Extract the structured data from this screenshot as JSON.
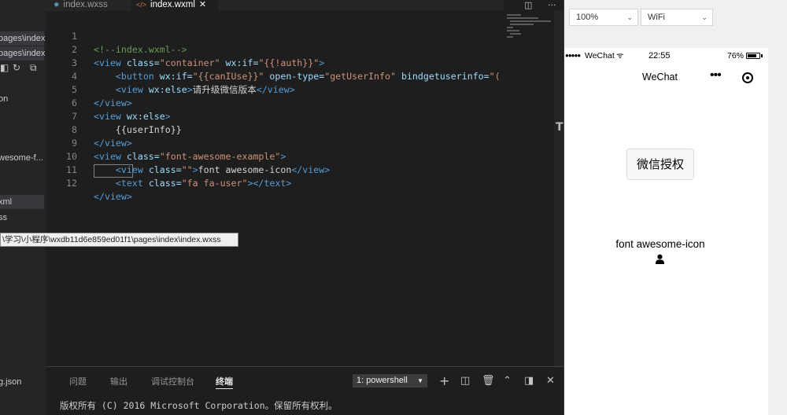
{
  "sidebar": {
    "items": [
      "pages\\index",
      "pages\\index",
      "on",
      "wesome-f...",
      "xml",
      "ss",
      "g.json"
    ]
  },
  "tabs": [
    {
      "label": "index.wxss",
      "icon": "css-file-icon"
    },
    {
      "label": "index.wxml",
      "icon": "xml-file-icon",
      "active": true
    }
  ],
  "editor": {
    "lines": [
      {
        "n": "1"
      },
      {
        "n": "2"
      },
      {
        "n": "3"
      },
      {
        "n": "4"
      },
      {
        "n": "5"
      },
      {
        "n": "6"
      },
      {
        "n": "7"
      },
      {
        "n": "8"
      },
      {
        "n": "9"
      },
      {
        "n": "10"
      },
      {
        "n": "11"
      },
      {
        "n": "12"
      }
    ],
    "tokens": {
      "l1": "<!--index.wxml-->",
      "l2_a": "<view",
      "l2_b": "class=",
      "l2_c": "\"container\"",
      "l2_d": "wx:if=",
      "l2_e": "\"{{!auth}}\"",
      "l2_f": ">",
      "l3_a": "<button",
      "l3_b": "wx:if=",
      "l3_c": "\"{{canIUse}}\"",
      "l3_d": "open-type=",
      "l3_e": "\"getUserInfo\"",
      "l3_f": "bindgetuserinfo=",
      "l3_g": "\"(",
      "l4_a": "<view",
      "l4_b": "wx:else",
      "l4_c": ">",
      "l4_d": "请升级微信版本",
      "l4_e": "</view>",
      "l5": "</view>",
      "l6_a": "<view",
      "l6_b": "wx:else",
      "l6_c": ">",
      "l7": "{{userInfo}}",
      "l8": "</view>",
      "l9_a": "<view",
      "l9_b": "class=",
      "l9_c": "\"font-awesome-example\"",
      "l9_d": ">",
      "l10_a": "<view",
      "l10_b": "class=",
      "l10_c": "\"\"",
      "l10_d": ">",
      "l10_e": "font awesome-icon",
      "l10_f": "</view>",
      "l11_a": "<text",
      "l11_b": "class=",
      "l11_c": "\"fa fa-user\"",
      "l11_d": "></text>",
      "l12": "</view>"
    }
  },
  "tooltip": "\\学习\\小程序\\wxdb11d6e859ed01f1\\pages\\index\\index.wxss",
  "panel": {
    "tabs": [
      "问题",
      "输出",
      "调试控制台",
      "终端"
    ],
    "active_tab": "终端",
    "terminal_select": "1: powershell",
    "output": "版权所有 (C) 2016 Microsoft Corporation。保留所有权利。"
  },
  "simulator": {
    "zoom": "100%",
    "network": "WiFi",
    "status": {
      "carrier": "WeChat",
      "time": "22:55",
      "battery": "76%",
      "battery_level": 0.76
    },
    "nav_title": "WeChat",
    "auth_button": "微信授权",
    "fa_text": "font awesome-icon"
  },
  "colors": {
    "editor_bg": "#1e1e1e",
    "sidebar_bg": "#252526",
    "selection": "#094771",
    "tag": "#569cd6",
    "attr": "#9cdcfe",
    "string": "#ce9178",
    "comment": "#6a9955"
  }
}
